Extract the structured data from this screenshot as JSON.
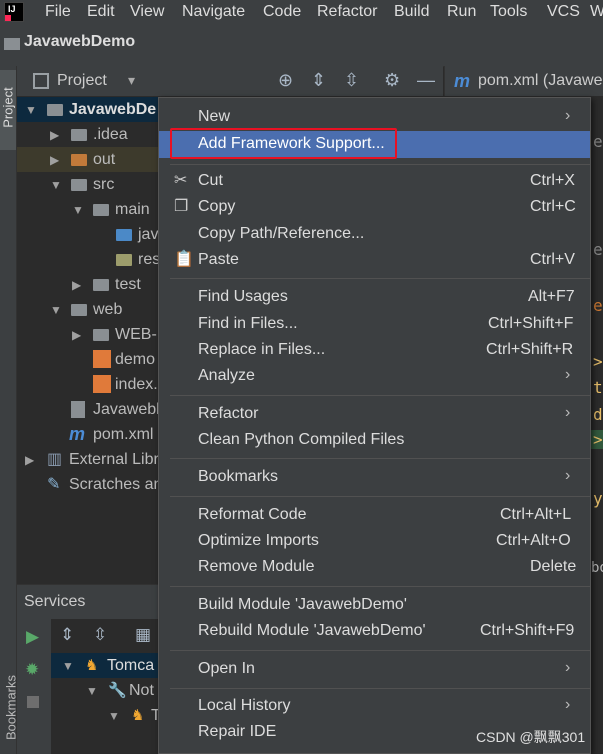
{
  "menubar": {
    "items": [
      "File",
      "Edit",
      "View",
      "Navigate",
      "Code",
      "Refactor",
      "Build",
      "Run",
      "Tools",
      "VCS",
      "W"
    ]
  },
  "window": {
    "project_name": "JavawebDemo"
  },
  "left_stripe": {
    "project_tab": "Project",
    "bookmarks_tab": "Bookmarks"
  },
  "project_panel": {
    "title": "Project"
  },
  "editor": {
    "tab_label": "pom.xml (Javawe"
  },
  "tree": {
    "rows": [
      {
        "label": "JavawebDe"
      },
      {
        "label": ".idea"
      },
      {
        "label": "out"
      },
      {
        "label": "src"
      },
      {
        "label": "main"
      },
      {
        "label": "jav"
      },
      {
        "label": "res"
      },
      {
        "label": "test"
      },
      {
        "label": "web"
      },
      {
        "label": "WEB-I"
      },
      {
        "label": "demo"
      },
      {
        "label": "index."
      },
      {
        "label": "Javawebl"
      },
      {
        "label": "pom.xml"
      },
      {
        "label": "External Libr"
      },
      {
        "label": "Scratches an"
      }
    ]
  },
  "services": {
    "title": "Services",
    "tree": [
      {
        "label": "Tomca"
      },
      {
        "label": "Not"
      },
      {
        "label": "T"
      }
    ]
  },
  "context_menu": {
    "items": [
      {
        "label": "New",
        "shortcut": "",
        "submenu": true
      },
      {
        "label": "Add Framework Support...",
        "shortcut": "",
        "highlighted": true
      },
      {
        "label": "Cut",
        "shortcut": "Ctrl+X",
        "icon": "scissors-icon"
      },
      {
        "label": "Copy",
        "shortcut": "Ctrl+C",
        "icon": "copy-icon"
      },
      {
        "label": "Copy Path/Reference...",
        "shortcut": ""
      },
      {
        "label": "Paste",
        "shortcut": "Ctrl+V",
        "icon": "clipboard-icon"
      },
      {
        "label": "Find Usages",
        "shortcut": "Alt+F7"
      },
      {
        "label": "Find in Files...",
        "shortcut": "Ctrl+Shift+F"
      },
      {
        "label": "Replace in Files...",
        "shortcut": "Ctrl+Shift+R"
      },
      {
        "label": "Analyze",
        "shortcut": "",
        "submenu": true
      },
      {
        "label": "Refactor",
        "shortcut": "",
        "submenu": true
      },
      {
        "label": "Clean Python Compiled Files",
        "shortcut": ""
      },
      {
        "label": "Bookmarks",
        "shortcut": "",
        "submenu": true
      },
      {
        "label": "Reformat Code",
        "shortcut": "Ctrl+Alt+L"
      },
      {
        "label": "Optimize Imports",
        "shortcut": "Ctrl+Alt+O"
      },
      {
        "label": "Remove Module",
        "shortcut": "Delete"
      },
      {
        "label": "Build Module 'JavawebDemo'",
        "shortcut": ""
      },
      {
        "label": "Rebuild Module 'JavawebDemo'",
        "shortcut": "Ctrl+Shift+F9"
      },
      {
        "label": "Open In",
        "shortcut": "",
        "submenu": true
      },
      {
        "label": "Local History",
        "shortcut": "",
        "submenu": true
      },
      {
        "label": "Repair IDE",
        "shortcut": ""
      }
    ]
  },
  "watermark": "CSDN @飘飘301",
  "colors": {
    "highlight": "#4b6eaf",
    "annotation_box": "#e81123",
    "menu_bg": "#3c3f41"
  }
}
